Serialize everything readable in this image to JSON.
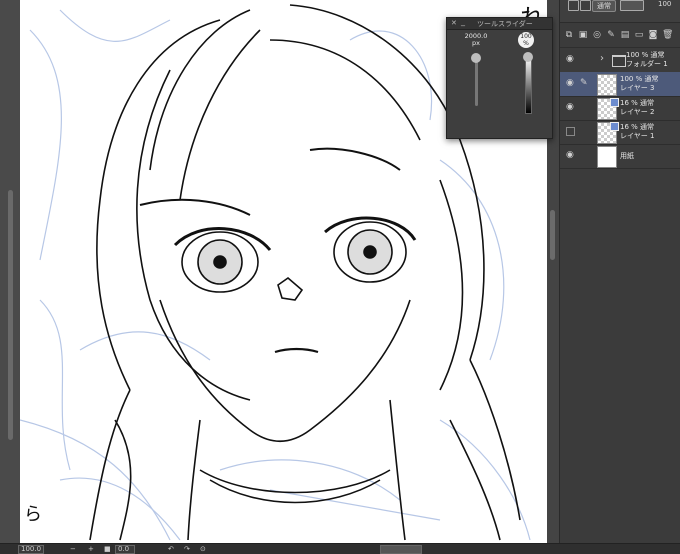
{
  "canvas": {
    "corner_glyph_top": "れ",
    "corner_glyph_bottom": "ら"
  },
  "layer_panel": {
    "blend_mode": "通常",
    "opacity": "100",
    "layers": [
      {
        "name": "フォルダー 1",
        "blend": "100 % 通常",
        "type": "folder",
        "selected": false
      },
      {
        "name": "レイヤー 3",
        "blend": "100 % 通常",
        "type": "raster",
        "selected": true
      },
      {
        "name": "レイヤー 2",
        "blend": "16 % 通常",
        "type": "raster",
        "selected": false
      },
      {
        "name": "レイヤー 1",
        "blend": "16 % 通常",
        "type": "raster",
        "selected": false
      },
      {
        "name": "用紙",
        "blend": "",
        "type": "paper",
        "selected": false
      }
    ]
  },
  "tool_slider": {
    "title": "ツールスライダー",
    "size_value": "2000.0",
    "size_unit": "px",
    "opacity_value": "100",
    "opacity_unit": "%"
  },
  "status_bar": {
    "zoom": "100.0",
    "angle": "0.0"
  },
  "colors": {
    "panel_bg": "#3b3b3b",
    "selected_layer": "#4d5a7a",
    "sketch_blue": "#b7c7e6"
  }
}
